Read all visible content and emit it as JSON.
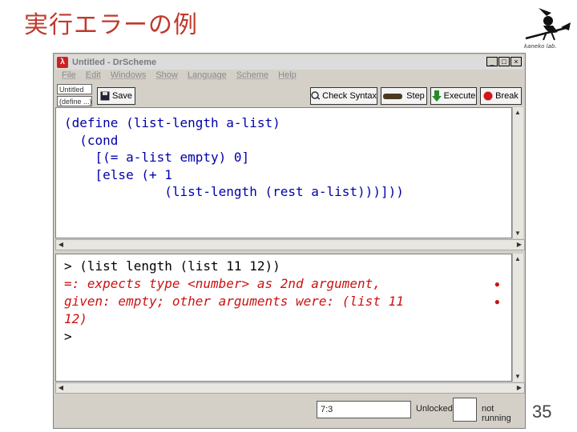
{
  "slide": {
    "title": "実行エラーの例",
    "page_number": "35",
    "logo_caption": "kaneko lab."
  },
  "window": {
    "title": "Untitled - DrScheme",
    "menu": [
      "File",
      "Edit",
      "Windows",
      "Show",
      "Language",
      "Scheme",
      "Help"
    ],
    "mini_labels": [
      "Untitled",
      "(define ...)"
    ],
    "toolbar": {
      "save": "Save",
      "check_syntax": "Check Syntax",
      "step": "Step",
      "execute": "Execute",
      "break": "Break"
    },
    "editor_lines": [
      "(define (list-length a-list)",
      "  (cond",
      "    [(= a-list empty) 0]",
      "    [else (+ 1",
      "             (list-length (rest a-list)))]))"
    ],
    "repl": {
      "input": "> (list length (list 11 12))",
      "error_lines": [
        "=: expects type <number> as 2nd argument,",
        "given: empty; other arguments were: (list 11",
        "12)"
      ],
      "prompt": ">"
    },
    "status": {
      "position": "7:3",
      "lock": "Unlocked",
      "running": "not running"
    }
  }
}
